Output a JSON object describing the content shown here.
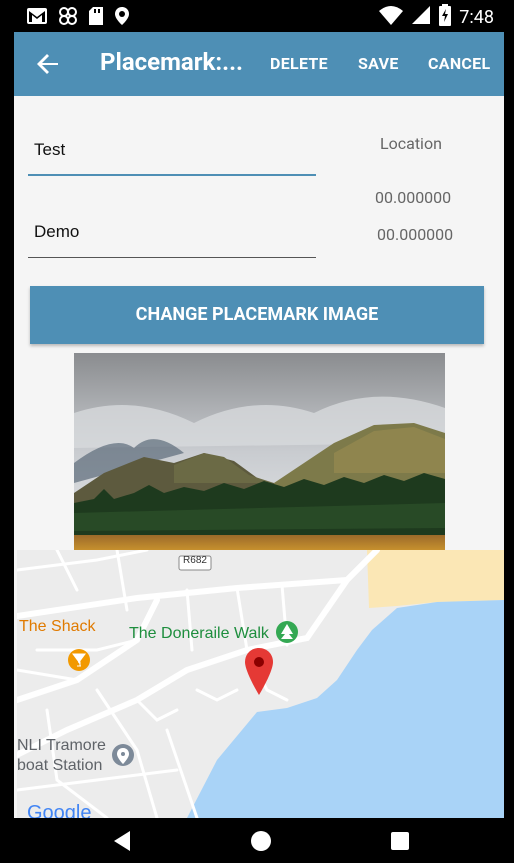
{
  "status_bar": {
    "time": "7:48"
  },
  "toolbar": {
    "title": "Placemark:...",
    "delete_label": "DELETE",
    "save_label": "SAVE",
    "cancel_label": "CANCEL"
  },
  "form": {
    "title_value": "Test",
    "description_value": "Demo",
    "location_label": "Location",
    "latitude": "00.000000",
    "longitude": "00.000000",
    "change_image_label": "CHANGE PLACEMARK IMAGE"
  },
  "map": {
    "road_badge": "R682",
    "places": {
      "shack": "The Shack",
      "doneraile": "The Doneraile Walk",
      "rnli_line1": "NLI Tramore",
      "rnli_line2": "boat Station"
    },
    "logo": "Google"
  },
  "colors": {
    "primary": "#4e8fb5",
    "water": "#a9d3f7",
    "sand": "#fbe7b5",
    "pin": "#e53935",
    "park_green": "#34a853",
    "food_orange": "#f29900"
  }
}
